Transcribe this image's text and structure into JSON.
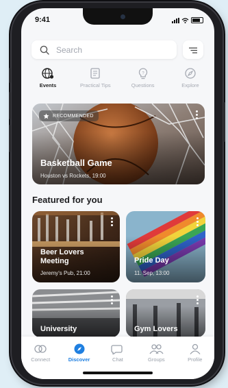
{
  "status": {
    "time": "9:41"
  },
  "search": {
    "placeholder": "Search"
  },
  "tabs": [
    {
      "label": "Events",
      "icon": "globe-icon",
      "active": true
    },
    {
      "label": "Practical Tips",
      "icon": "book-icon",
      "active": false
    },
    {
      "label": "Questions",
      "icon": "lightbulb-icon",
      "active": false
    },
    {
      "label": "Explore",
      "icon": "compass-icon",
      "active": false
    }
  ],
  "hero": {
    "badge": "RECOMMENDED",
    "title": "Basketball Game",
    "subtitle": "Houston vs Rockets, 19:00"
  },
  "featured": {
    "title": "Featured for you",
    "cards": [
      {
        "title": "Beer Lovers Meeting",
        "subtitle": "Jeremy's Pub, 21:00"
      },
      {
        "title": "Pride Day",
        "subtitle": "11. Sep, 13:00"
      },
      {
        "title": "University",
        "subtitle": ""
      },
      {
        "title": "Gym Lovers",
        "subtitle": ""
      }
    ]
  },
  "nav": [
    {
      "label": "Connect",
      "icon": "connect-icon",
      "active": false
    },
    {
      "label": "Discover",
      "icon": "discover-icon",
      "active": true
    },
    {
      "label": "Chat",
      "icon": "chat-icon",
      "active": false
    },
    {
      "label": "Groups",
      "icon": "groups-icon",
      "active": false
    },
    {
      "label": "Profile",
      "icon": "profile-icon",
      "active": false
    }
  ],
  "colors": {
    "accent": "#1f7fe0",
    "background": "#f6f7f9",
    "inactive": "#9aa0aa"
  }
}
